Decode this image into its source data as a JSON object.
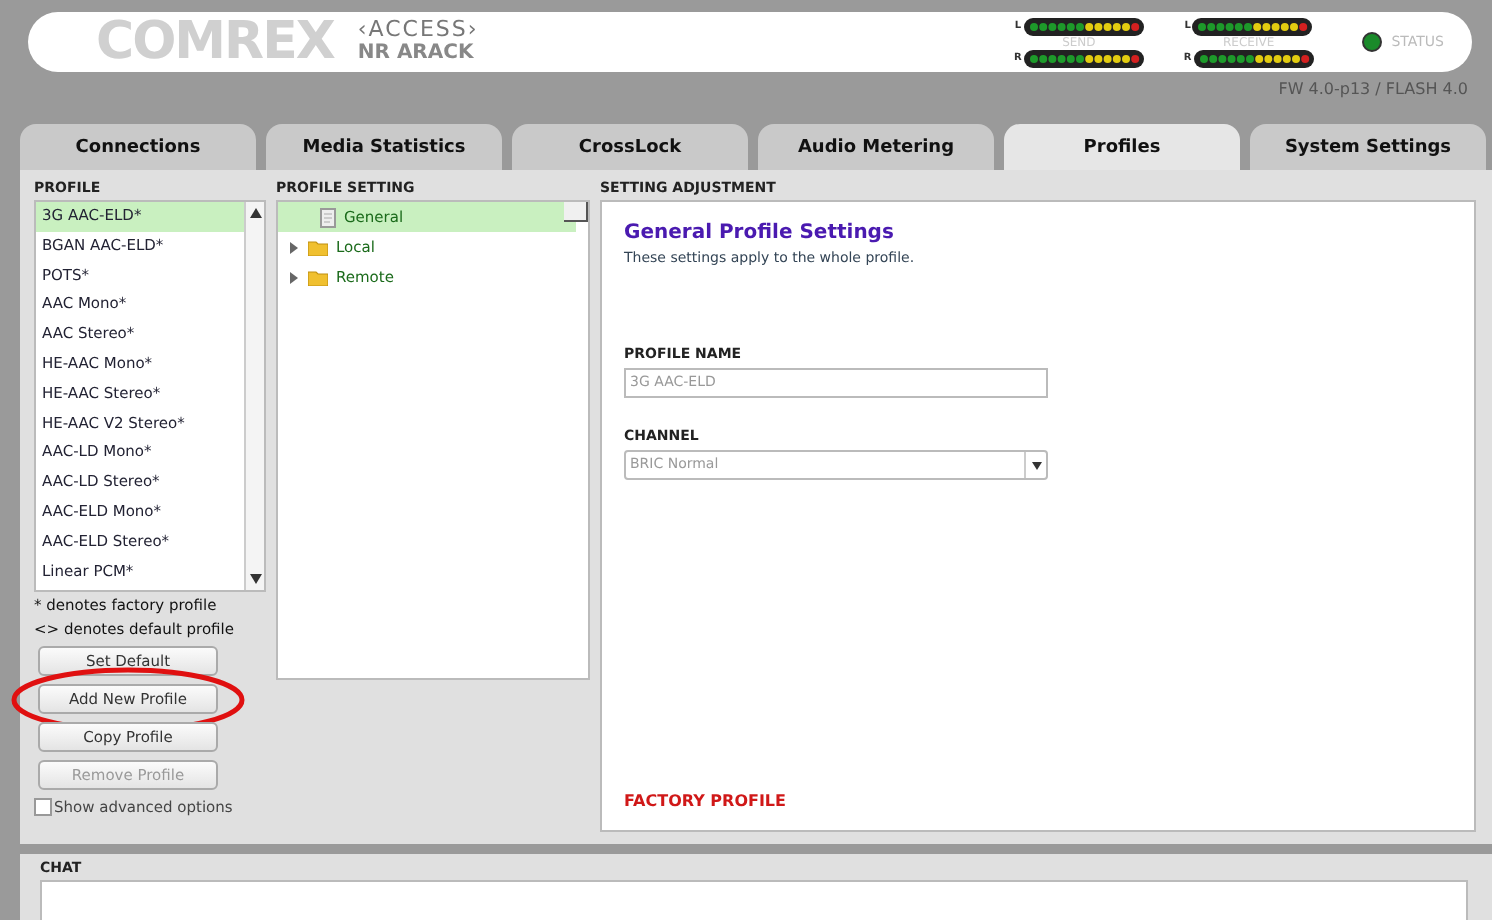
{
  "header": {
    "logo": "COMREX",
    "product": "‹ACCESS›",
    "device_name": "NR ARACK",
    "meters": [
      {
        "label": "SEND",
        "channels": [
          "L",
          "R"
        ]
      },
      {
        "label": "RECEIVE",
        "channels": [
          "L",
          "R"
        ]
      }
    ],
    "status": {
      "label": "STATUS",
      "color": "#1a8a2a"
    },
    "firmware": "FW 4.0-p13 / FLASH 4.0"
  },
  "tabs": [
    {
      "label": "Connections",
      "selected": false
    },
    {
      "label": "Media Statistics",
      "selected": false
    },
    {
      "label": "CrossLock",
      "selected": false
    },
    {
      "label": "Audio Metering",
      "selected": false
    },
    {
      "label": "Profiles",
      "selected": true
    },
    {
      "label": "System Settings",
      "selected": false
    }
  ],
  "profile": {
    "heading": "PROFILE",
    "items": [
      {
        "label": "3G AAC-ELD*",
        "selected": true
      },
      {
        "label": "BGAN AAC-ELD*",
        "selected": false
      },
      {
        "label": "POTS*",
        "selected": false
      },
      {
        "label": "AAC Mono*",
        "selected": false
      },
      {
        "label": "AAC Stereo*",
        "selected": false
      },
      {
        "label": "HE-AAC Mono*",
        "selected": false
      },
      {
        "label": "HE-AAC Stereo*",
        "selected": false
      },
      {
        "label": "HE-AAC V2 Stereo*",
        "selected": false
      },
      {
        "label": "AAC-LD Mono*",
        "selected": false
      },
      {
        "label": "AAC-LD Stereo*",
        "selected": false
      },
      {
        "label": "AAC-ELD Mono*",
        "selected": false
      },
      {
        "label": "AAC-ELD Stereo*",
        "selected": false
      },
      {
        "label": "Linear PCM*",
        "selected": false
      }
    ],
    "notes": [
      "* denotes factory profile",
      "<> denotes default profile"
    ],
    "buttons": [
      {
        "label": "Set Default",
        "disabled": false,
        "highlighted": false
      },
      {
        "label": "Add New Profile",
        "disabled": false,
        "highlighted": true
      },
      {
        "label": "Copy Profile",
        "disabled": false,
        "highlighted": false
      },
      {
        "label": "Remove Profile",
        "disabled": true,
        "highlighted": false
      }
    ],
    "advanced": {
      "label": "Show advanced options",
      "checked": false
    }
  },
  "profile_setting": {
    "heading": "PROFILE SETTING",
    "items": [
      {
        "label": "General",
        "kind": "page",
        "selected": true
      },
      {
        "label": "Local",
        "kind": "folder",
        "expanded": false,
        "selected": false
      },
      {
        "label": "Remote",
        "kind": "folder",
        "expanded": false,
        "selected": false
      }
    ]
  },
  "setting_adjustment": {
    "heading": "SETTING ADJUSTMENT",
    "title": "General Profile Settings",
    "description": "These settings apply to the whole profile.",
    "fields": [
      {
        "label": "PROFILE NAME",
        "kind": "text",
        "value": "3G AAC-ELD"
      },
      {
        "label": "CHANNEL",
        "kind": "select",
        "value": "BRIC Normal"
      }
    ],
    "footer": "FACTORY PROFILE"
  },
  "chat": {
    "heading": "CHAT"
  }
}
